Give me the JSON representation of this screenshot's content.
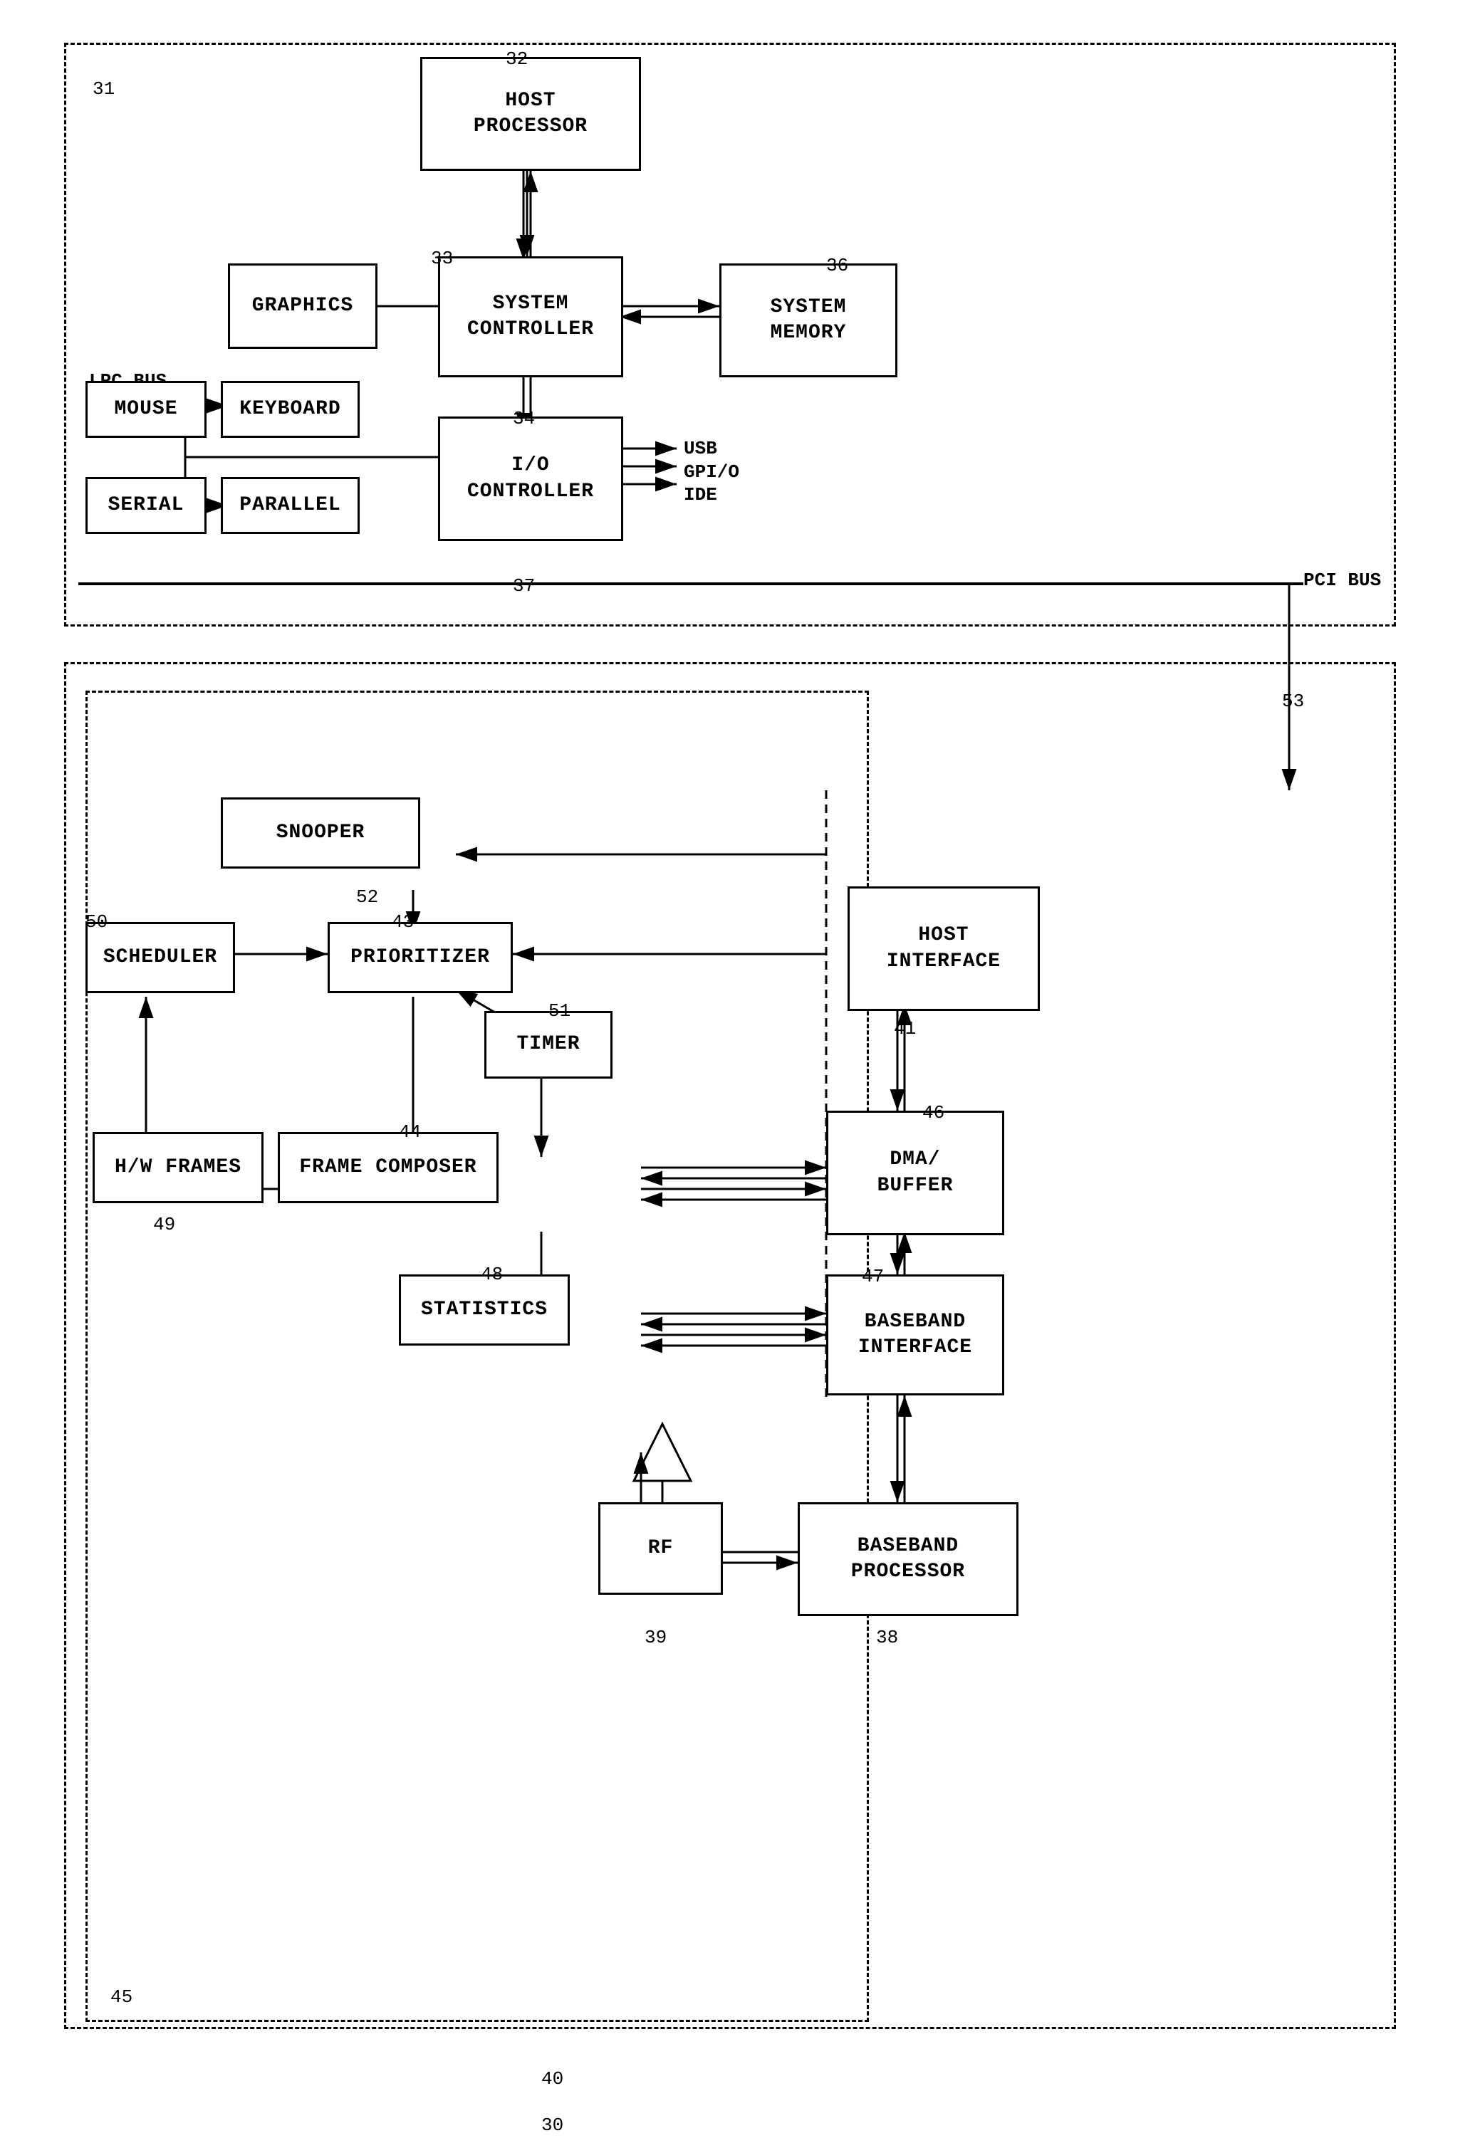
{
  "diagram": {
    "ref30": "30",
    "ref31": "31",
    "ref32": "32",
    "ref33": "33",
    "ref34": "34",
    "ref36": "36",
    "ref37": "37",
    "ref38": "38",
    "ref39": "39",
    "ref40": "40",
    "ref41": "41",
    "ref43": "43",
    "ref44": "44",
    "ref45": "45",
    "ref46": "46",
    "ref47": "47",
    "ref48": "48",
    "ref49": "49",
    "ref50": "50",
    "ref51": "51",
    "ref52": "52",
    "ref53": "53",
    "blocks": {
      "host_processor": "HOST\nPROCESSOR",
      "system_controller": "SYSTEM\nCONTROLLER",
      "system_memory": "SYSTEM\nMEMORY",
      "graphics": "GRAPHICS",
      "io_controller": "I/O\nCONTROLLER",
      "mouse": "MOUSE",
      "keyboard": "KEYBOARD",
      "serial": "SERIAL",
      "parallel": "PARALLEL",
      "usb": "USB",
      "gpio": "GPI/O",
      "ide": "IDE",
      "pci_bus": "PCI BUS",
      "lpc_bus": "LPC BUS",
      "snooper": "SNOOPER",
      "scheduler": "SCHEDULER",
      "prioritizer": "PRIORITIZER",
      "timer": "TIMER",
      "hw_frames": "H/W FRAMES",
      "frame_composer": "FRAME COMPOSER",
      "statistics": "STATISTICS",
      "host_interface": "HOST\nINTERFACE",
      "dma_buffer": "DMA/\nBUFFER",
      "baseband_interface": "BASEBAND\nINTERFACE",
      "baseband_processor": "BASEBAND\nPROCESSOR",
      "rf": "RF"
    }
  }
}
